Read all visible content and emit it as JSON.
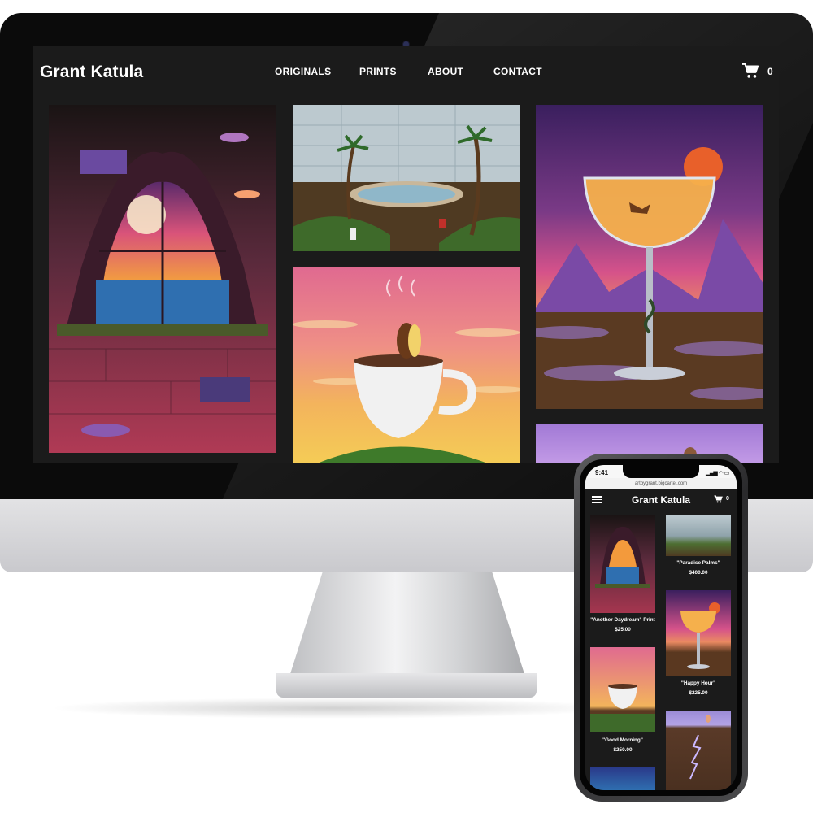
{
  "site": {
    "brand": "Grant Katula",
    "nav": [
      "ORIGINALS",
      "PRINTS",
      "ABOUT",
      "CONTACT"
    ],
    "cart_count": "0"
  },
  "colors": {
    "background": "#1b1b1b",
    "text": "#ffffff"
  },
  "mobile": {
    "time": "9:41",
    "url": "artbygrant.bigcartel.com",
    "brand": "Grant Katula",
    "cart_count": "0",
    "products": [
      {
        "title": "\"Another Daydream\" Print",
        "price": "$25.00"
      },
      {
        "title": "\"Paradise Palms\"",
        "price": "$400.00"
      },
      {
        "title": "\"Happy Hour\"",
        "price": "$225.00"
      },
      {
        "title": "\"Good Morning\"",
        "price": "$250.00"
      }
    ]
  }
}
